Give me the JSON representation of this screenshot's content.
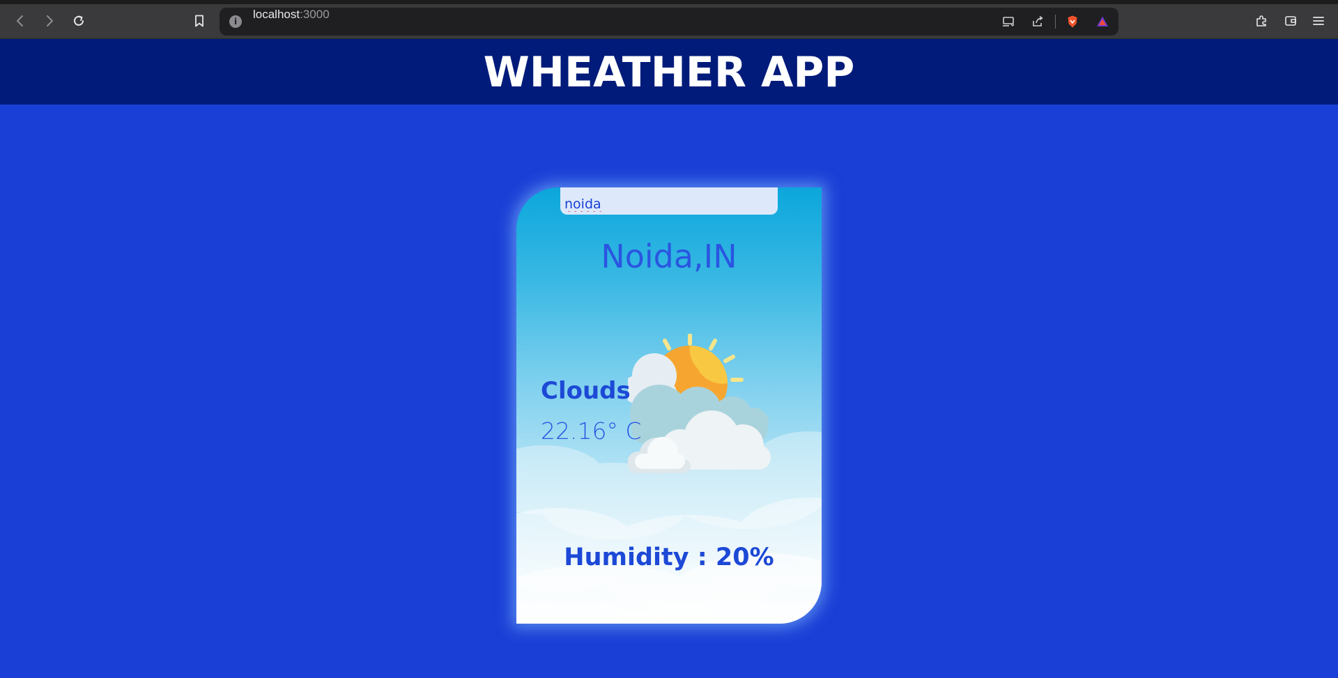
{
  "browser": {
    "url_host": "localhost",
    "url_port": ":3000",
    "info_icon": "i",
    "icons": [
      "back-icon",
      "forward-icon",
      "reload-icon",
      "bookmark-icon",
      "info-icon",
      "cast-icon",
      "share-icon",
      "brave-shield-icon",
      "brave-rewards-icon",
      "extensions-icon",
      "wallet-icon",
      "menu-icon"
    ]
  },
  "header": {
    "title": "WHEATHER APP"
  },
  "search": {
    "value": "noida"
  },
  "weather": {
    "city": "Noida,IN",
    "condition": "Clouds",
    "temperature": "22.16° C",
    "humidity": "Humidity : 20%",
    "icon": "sun-behind-clouds-icon"
  },
  "colors": {
    "page_bg": "#1a3fd6",
    "header_bg": "#001b7a",
    "text_blue": "#1d49d6",
    "input_bg": "#dde9fb"
  }
}
